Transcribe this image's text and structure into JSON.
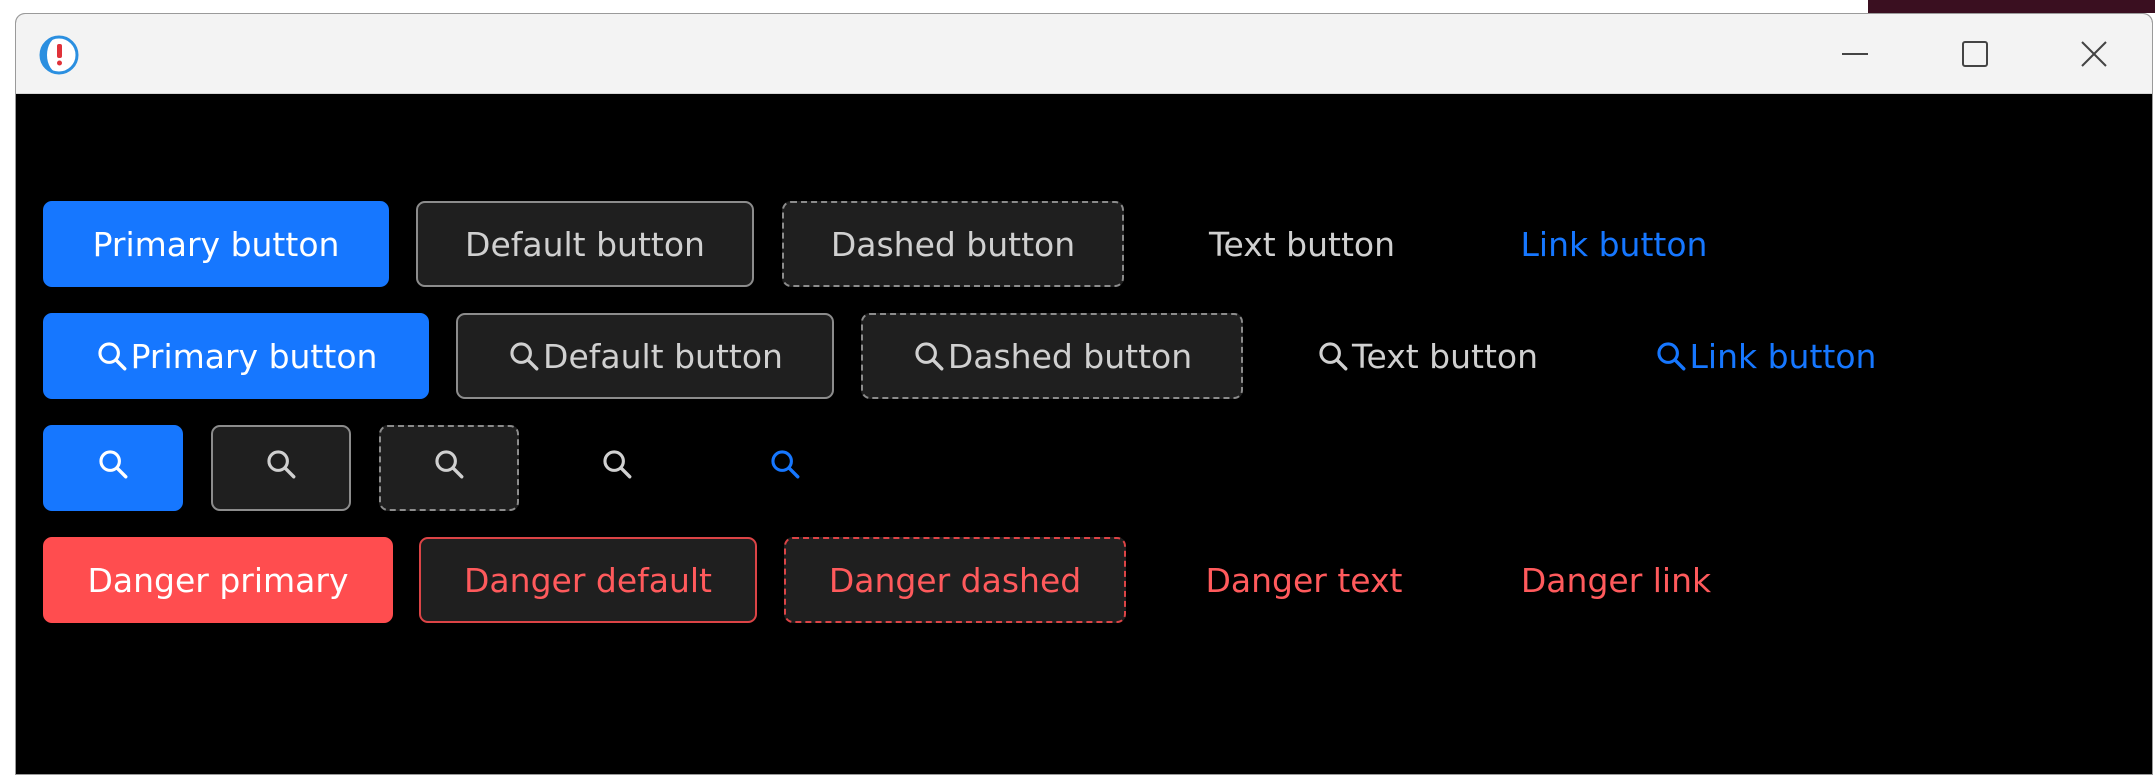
{
  "colors": {
    "primary": "#1677ff",
    "danger": "#ff4d4f",
    "window_bg": "#000000",
    "button_dark_bg": "#1f1f1f",
    "text_gray": "#d0d0d0",
    "border_gray": "#8c8c8c"
  },
  "titlebar": {
    "app_icon": "app-logo-icon",
    "minimize_icon": "minimize-icon",
    "maximize_icon": "maximize-icon",
    "close_icon": "close-icon"
  },
  "row1": {
    "primary": "Primary button",
    "default": "Default button",
    "dashed": "Dashed button",
    "text": "Text button",
    "link": "Link button"
  },
  "row2": {
    "icon": "search-icon",
    "primary": "Primary button",
    "default": "Default button",
    "dashed": "Dashed button",
    "text": "Text button",
    "link": "Link button"
  },
  "row3": {
    "icon": "search-icon"
  },
  "row4": {
    "primary": "Danger primary",
    "default": "Danger default",
    "dashed": "Danger dashed",
    "text": "Danger text",
    "link": "Danger link"
  }
}
